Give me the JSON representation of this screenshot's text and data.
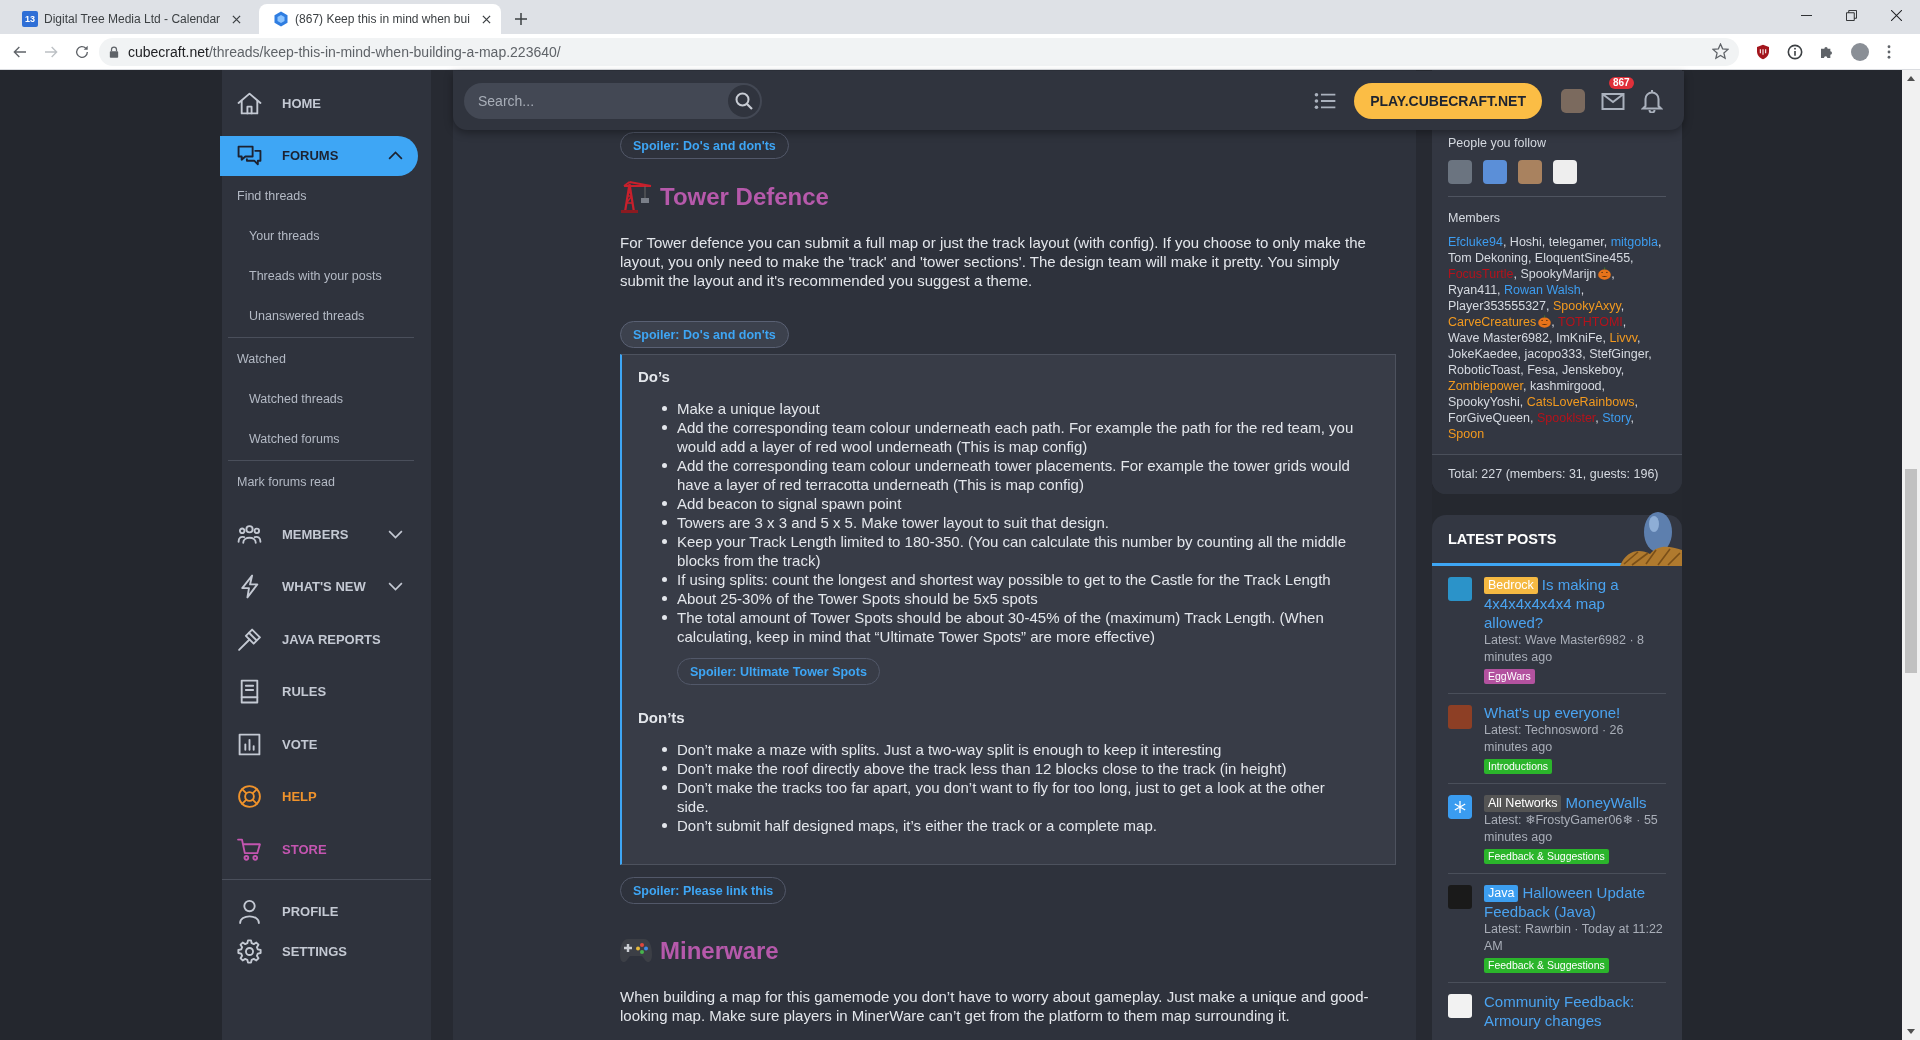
{
  "browser": {
    "tabs": [
      {
        "title": "Digital Tree Media Ltd - Calendar",
        "favicon_text": "13",
        "selected": false
      },
      {
        "title": "(867) Keep this in mind when bui",
        "selected": true
      }
    ],
    "url_host": "cubecraft.net",
    "url_path": "/threads/keep-this-in-mind-when-building-a-map.223640/"
  },
  "sidebar": {
    "nav": [
      {
        "label": "HOME",
        "selected": false
      },
      {
        "label": "FORUMS",
        "selected": true,
        "expanded": true,
        "children": [
          {
            "label": "Find threads",
            "children": [
              {
                "label": "Your threads"
              },
              {
                "label": "Threads with your posts"
              },
              {
                "label": "Unanswered threads"
              }
            ]
          },
          {
            "label": "Watched",
            "children": [
              {
                "label": "Watched threads"
              },
              {
                "label": "Watched forums"
              }
            ]
          },
          {
            "label": "Mark forums read"
          }
        ]
      },
      {
        "label": "MEMBERS",
        "selected": false,
        "expanded": false
      },
      {
        "label": "WHAT'S NEW",
        "selected": false,
        "expanded": false
      },
      {
        "label": "JAVA REPORTS",
        "selected": false
      },
      {
        "label": "RULES",
        "selected": false
      },
      {
        "label": "VOTE",
        "selected": false
      },
      {
        "label": "HELP",
        "selected": false,
        "color": "#f0932b"
      },
      {
        "label": "STORE",
        "selected": false,
        "color": "#c455b0"
      }
    ],
    "account": [
      {
        "label": "PROFILE",
        "selected": false
      },
      {
        "label": "SETTINGS",
        "selected": false
      }
    ]
  },
  "header": {
    "search": {
      "placeholder": "Search..."
    },
    "play_button": "PLAY.CUBECRAFT.NET",
    "mail_count": "867"
  },
  "post": {
    "blocks": [
      {
        "kind": "spoiler",
        "label": "Spoiler: Do's and don'ts",
        "expanded": false
      },
      {
        "kind": "heading",
        "text": "Tower Defence"
      },
      {
        "kind": "paragraph",
        "text": "For Tower defence you can submit a full map or just the track layout (with config). If you choose to only make the layout, you only need to make the 'track' and 'tower sections'. The design team will make it pretty. You simply submit the layout and it's recommended you suggest a theme."
      },
      {
        "kind": "spoiler",
        "label": "Spoiler: Do's and don'ts",
        "expanded": true,
        "sections": [
          {
            "title": "Do’s",
            "items": [
              "Make a unique layout",
              "Add the corresponding team colour underneath each path. For example the path for the red team, you would add a layer of red wool underneath (This is map config)",
              "Add the corresponding team colour underneath tower placements. For example the tower grids would have a layer of red terracotta underneath (This is map config)",
              "Add beacon to signal spawn point",
              "Towers are 3 x 3 and 5 x 5. Make tower layout to suit that design.",
              "Keep your Track Length limited to 180-350. (You can calculate this number by counting all the middle blocks from the track)",
              "If using splits: count the longest and shortest way possible to get to the Castle for the Track Length",
              "About 25-30% of the Tower Spots should be 5x5 spots",
              "The total amount of Tower Spots should be about 30-45% of the (maximum) Track Length. (When calculating, keep in mind that “Ultimate Tower Spots” are more effective)"
            ],
            "spoiler": {
              "label": "Spoiler: Ultimate Tower Spots",
              "expanded": false
            }
          },
          {
            "title": "Don’ts",
            "items": [
              "Don’t make a maze with splits. Just a two-way split is enough to keep it interesting",
              "Don’t make the roof directly above the track less than 12 blocks close to the track (in height)",
              "Don’t make the tracks too far apart, you don’t want to fly for too long, just to get a look at the other side.",
              "Don’t submit half designed maps, it’s either the track or a complete map."
            ]
          }
        ]
      },
      {
        "kind": "spoiler",
        "label": "Spoiler: Please link this",
        "expanded": false
      },
      {
        "kind": "heading",
        "text": "Minerware"
      },
      {
        "kind": "paragraph",
        "text": "When building a map for this gamemode you don’t have to worry about gameplay. Just make a unique and good-looking map. Make sure players in MinerWare can’t get from the platform to them map surrounding it."
      }
    ]
  },
  "online": {
    "following_title": "People you follow",
    "members_title": "Members",
    "separator": ", ",
    "members": [
      {
        "name": "Efcluke94",
        "color": "#3d9df0",
        "has_badge": false
      },
      {
        "name": "Hoshi",
        "color": "#d6dae1",
        "has_badge": false
      },
      {
        "name": "telegamer",
        "color": "#d6dae1",
        "has_badge": false
      },
      {
        "name": "mitgobla",
        "color": "#3d9df0",
        "has_badge": false
      },
      {
        "name": "Tom Dekoning",
        "color": "#d6dae1",
        "has_badge": false
      },
      {
        "name": "EloquentSine455",
        "color": "#d6dae1",
        "has_badge": false
      },
      {
        "name": "FocusTurtle",
        "color": "#b5121b",
        "has_badge": false
      },
      {
        "name": "SpookyMarijn",
        "color": "#d6dae1",
        "has_badge": true
      },
      {
        "name": "Ryan411",
        "color": "#d6dae1",
        "has_badge": false
      },
      {
        "name": "Rowan Walsh",
        "color": "#3d9df0",
        "has_badge": false
      },
      {
        "name": "Player353555327",
        "color": "#d6dae1",
        "has_badge": false
      },
      {
        "name": "SpookyAxyy",
        "color": "#f39a1f",
        "has_badge": false
      },
      {
        "name": "CarveCreatures",
        "color": "#f39a1f",
        "has_badge": true
      },
      {
        "name": "TOTHTOMI",
        "color": "#b5121b",
        "has_badge": false
      },
      {
        "name": "Wave Master6982",
        "color": "#d6dae1",
        "has_badge": false
      },
      {
        "name": "ImKniFe",
        "color": "#d6dae1",
        "has_badge": false
      },
      {
        "name": "Livvv",
        "color": "#f39a1f",
        "has_badge": false
      },
      {
        "name": "JokeKaedee",
        "color": "#d6dae1",
        "has_badge": false
      },
      {
        "name": "jacopo333",
        "color": "#d6dae1",
        "has_badge": false
      },
      {
        "name": "StefGinger",
        "color": "#d6dae1",
        "has_badge": false
      },
      {
        "name": "RoboticToast",
        "color": "#d6dae1",
        "has_badge": false
      },
      {
        "name": "Fesa",
        "color": "#d6dae1",
        "has_badge": false
      },
      {
        "name": "Jenskeboy",
        "color": "#d6dae1",
        "has_badge": false
      },
      {
        "name": "Zombiepower",
        "color": "#f39a1f",
        "has_badge": false
      },
      {
        "name": "kashmirgood",
        "color": "#d6dae1",
        "has_badge": false
      },
      {
        "name": "SpookyYoshi",
        "color": "#d6dae1",
        "has_badge": false
      },
      {
        "name": "CatsLoveRainbows",
        "color": "#f39a1f",
        "has_badge": false
      },
      {
        "name": "ForGiveQueen",
        "color": "#d6dae1",
        "has_badge": false
      },
      {
        "name": "Spooklster",
        "color": "#b5121b",
        "has_badge": false
      },
      {
        "name": "Story",
        "color": "#3d9df0",
        "has_badge": false
      },
      {
        "name": "Spoon",
        "color": "#f39a1f",
        "has_badge": false
      }
    ],
    "total": "Total: 227 (members: 31, guests: 196)"
  },
  "latest_posts": {
    "title": "LATEST POSTS",
    "posts": [
      {
        "prefix": {
          "label": "Bedrock",
          "color": "#f5b942"
        },
        "title": "Is making a 4x4x4x4x4x4 map allowed?",
        "meta": "Latest: Wave Master6982 · 8 minutes ago",
        "tag": {
          "label": "EggWars",
          "color": "#b3529f"
        }
      },
      {
        "title": "What's up everyone!",
        "meta": "Latest: Technosword · 26 minutes ago",
        "tag": {
          "label": "Introductions",
          "color": "#2bb52b"
        }
      },
      {
        "prefix": {
          "label": "All Networks",
          "color": "#545454"
        },
        "title": "MoneyWalls",
        "meta": "Latest: ❄FrostyGamer06❄ · 55 minutes ago",
        "tag": {
          "label": "Feedback & Suggestions",
          "color": "#2bb52b"
        }
      },
      {
        "prefix": {
          "label": "Java",
          "color": "#3c9ef0"
        },
        "title": "Halloween Update Feedback (Java)",
        "meta": "Latest: Rawrbin · Today at 11:22 AM",
        "tag": {
          "label": "Feedback & Suggestions",
          "color": "#2bb52b"
        }
      },
      {
        "title": "Community Feedback: Armoury changes"
      }
    ]
  }
}
